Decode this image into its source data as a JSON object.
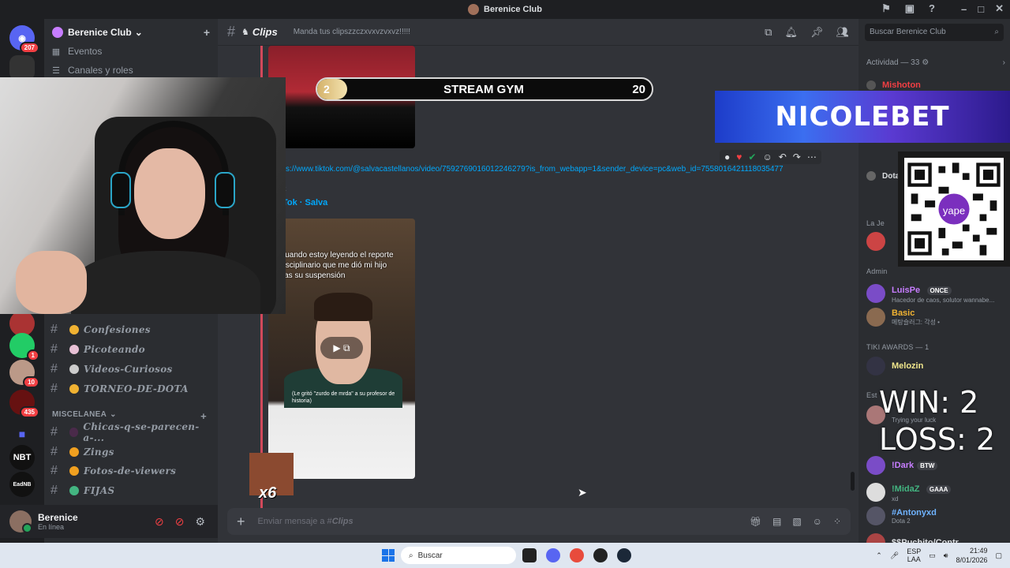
{
  "window": {
    "title": "Berenice Club"
  },
  "rail": {
    "badges": [
      "207",
      "1",
      "10",
      "435"
    ],
    "labels": [
      "NBT",
      "EadNB"
    ]
  },
  "sidebar": {
    "server_name": "Berenice Club",
    "top_items": [
      {
        "label": "Eventos"
      },
      {
        "label": "Canales y roles"
      }
    ],
    "channels_top": [
      {
        "name": "Confesiones"
      },
      {
        "name": "Picoteando"
      },
      {
        "name": "Videos-Curiosos"
      },
      {
        "name": "TORNEO-DE-DOTA"
      }
    ],
    "category": "MISCELANEA",
    "channels_misc": [
      {
        "name": "Chicas-q-se-parecen-a-..."
      },
      {
        "name": "Zings"
      },
      {
        "name": "Fotos-de-viewers"
      },
      {
        "name": "FIJAS"
      }
    ]
  },
  "user": {
    "name": "Berenice",
    "status": "En línea"
  },
  "chat": {
    "channel_name": "Clips",
    "topic": "Manda tus clipszzczxvxvzvxvz!!!!!",
    "link": "s://www.tiktok.com/@salvacastellanos/video/7592769016012246279?is_from_webapp=1&sender_device=pc&web_id=75580164211180354​77",
    "embed_small": "k",
    "embed_author": "Tok · Salva",
    "video_caption": "Cuando estoy leyendo el reporte disciplinario que me dió mi hijo tras su suspensión",
    "video_subcaption": "(Le gritó \"zurdo de mrda\" a su profesor de historia)",
    "composer_placeholder_prefix": "Enviar mensaje a #",
    "composer_channel": "Clips"
  },
  "members": {
    "search_placeholder": "Buscar Berenice Club",
    "activity": "Actividad — 33",
    "sections": {
      "admin": "Admin",
      "tiki": "TIKI AWARDS — 1",
      "estr": "Est",
      "laj": "La Je"
    },
    "list": [
      {
        "name": "Mishoton",
        "color": "#f23f43"
      },
      {
        "name": "Dota",
        "color": "#dbdee1"
      },
      {
        "name": "LuisPe",
        "tag": "ONCE",
        "sub": "Hacedor de caos, solutor wannabe...",
        "color": "#c77dff"
      },
      {
        "name": "Basic",
        "sub": "메탕슬러그: 각성 •",
        "color": "#f0b232"
      },
      {
        "name": "Melozin",
        "color": "#f0e68c"
      },
      {
        "name": "!Dark",
        "tag": "BTW",
        "color": "#c77dff"
      },
      {
        "name": "!MidaZ",
        "tag": "GAAA",
        "sub": "xd",
        "color": "#43b581"
      },
      {
        "name": "#Antonyxd",
        "sub": "Dota 2",
        "color": "#6fb3ff"
      },
      {
        "name": "$$Puchito/Contr",
        "color": "#dbdee1"
      }
    ],
    "trying_luck": "Trying your luck"
  },
  "overlays": {
    "stream_gym": {
      "level": "2",
      "name": "STREAM GYM",
      "count": "20"
    },
    "sponsor": "NICOLEBET",
    "win": "WIN: 2",
    "loss": "LOSS: 2",
    "emote_multiplier": "x6",
    "qr_label": "yape"
  },
  "taskbar": {
    "search": "Buscar",
    "lang": "ESP",
    "lang_sub": "LAA",
    "time": "21:49",
    "date": "8/01/2026"
  },
  "colors": {
    "accent": "#5865f2",
    "link": "#00a8fc",
    "online": "#23a55a"
  }
}
